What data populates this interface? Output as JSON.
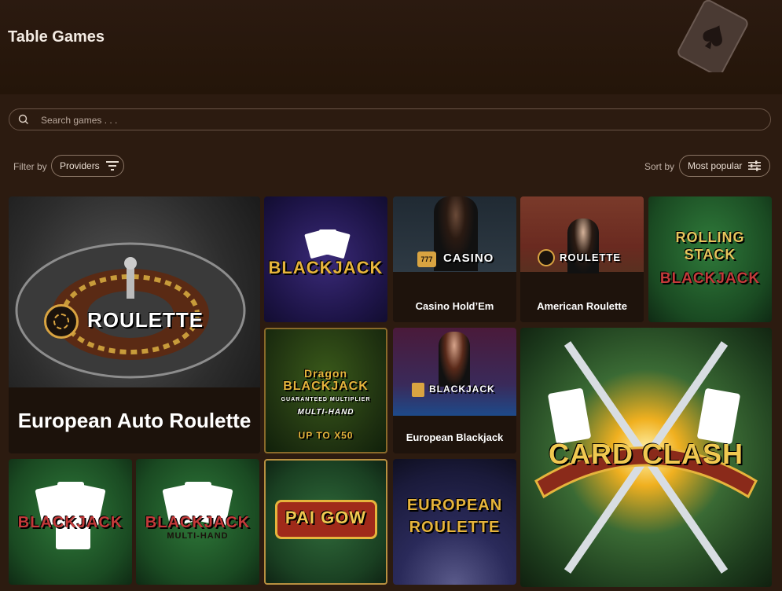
{
  "header": {
    "title": "Table Games"
  },
  "search": {
    "placeholder": "Search games . . ."
  },
  "filter": {
    "label": "Filter by",
    "providers_label": "Providers"
  },
  "sort": {
    "label": "Sort by",
    "selected": "Most popular"
  },
  "games": [
    {
      "caption": "European Auto Roulette",
      "logo": "ROULETTE"
    },
    {
      "logo": "BLACKJACK"
    },
    {
      "caption": "Casino Hold’Em",
      "logo": "CASINO",
      "badge": "777"
    },
    {
      "caption": "American Roulette",
      "logo": "ROULETTE"
    },
    {
      "logo_lines": [
        "ROLLING",
        "STACK",
        "BLACKJACK"
      ]
    },
    {
      "logo_lines": [
        "Dragon",
        "BLACKJACK",
        "GUARANTEED MULTIPLIER",
        "MULTI-HAND",
        "UP TO X50"
      ]
    },
    {
      "caption": "European Blackjack",
      "logo": "BLACKJACK"
    },
    {
      "logo": "CARD CLASH"
    },
    {
      "logo": "BLACKJACK"
    },
    {
      "logo_lines": [
        "BLACKJACK",
        "MULTI-HAND"
      ]
    },
    {
      "logo": "PAI GOW"
    },
    {
      "logo_lines": [
        "EUROPEAN",
        "ROULETTE"
      ]
    }
  ],
  "colors": {
    "background": "#2c1b10",
    "caption_bg": "#1e130c",
    "gold": "#e6b43c"
  }
}
